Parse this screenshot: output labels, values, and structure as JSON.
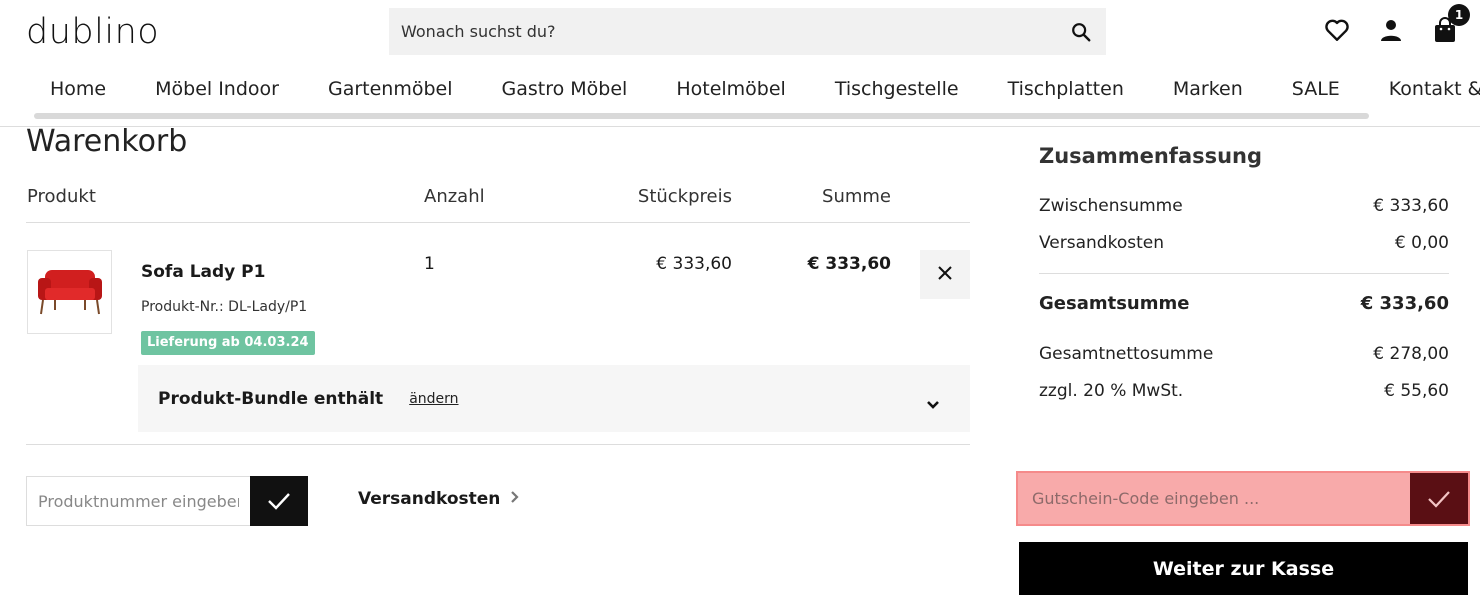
{
  "header": {
    "logo": "dublino",
    "search_placeholder": "Wonach suchst du?",
    "cart_count": "1",
    "icons": [
      "search-icon",
      "heart-icon",
      "user-icon",
      "bag-icon"
    ]
  },
  "nav": {
    "items": [
      "Home",
      "Möbel Indoor",
      "Gartenmöbel",
      "Gastro Möbel",
      "Hotelmöbel",
      "Tischgestelle",
      "Tischplatten",
      "Marken",
      "SALE",
      "Kontakt & Showroom"
    ]
  },
  "cart": {
    "title": "Warenkorb",
    "columns": {
      "product": "Produkt",
      "quantity": "Anzahl",
      "unit_price": "Stückpreis",
      "sum": "Summe"
    },
    "item": {
      "name": "Sofa Lady P1",
      "number": "Produkt-Nr.: DL-Lady/P1",
      "delivery": "Lieferung ab 04.03.24",
      "quantity": "1",
      "unit_price": "€ 333,60",
      "sum": "€ 333,60",
      "bundle_title": "Produkt-Bundle enthält",
      "bundle_change": "ändern"
    },
    "product_input_placeholder": "Produktnummer eingeben ...",
    "shipping_link": "Versandkosten"
  },
  "summary": {
    "title": "Zusammenfassung",
    "subtotal_label": "Zwischensumme",
    "subtotal": "€ 333,60",
    "shipping_label": "Versandkosten",
    "shipping": "€ 0,00",
    "total_label": "Gesamtsumme",
    "total": "€ 333,60",
    "net_label": "Gesamtnettosumme",
    "net": "€ 278,00",
    "vat_label": "zzgl. 20 % MwSt.",
    "vat": "€ 55,60",
    "voucher_placeholder": "Gutschein-Code eingeben ...",
    "checkout_label": "Weiter zur Kasse"
  },
  "colors": {
    "delivery_badge": "#6fc4a1",
    "voucher_bg": "#f8aaaa",
    "voucher_button": "#5a0f14",
    "product_red": "#d11f1f"
  }
}
